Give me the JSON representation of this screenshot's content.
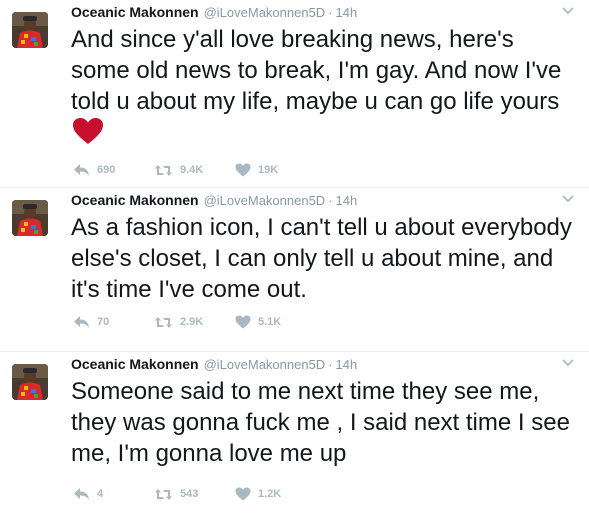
{
  "tweets": [
    {
      "name": "Oceanic Makonnen",
      "handle": "@iLoveMakonnen5D",
      "separator": "·",
      "time": "14h",
      "text": "And since y'all love breaking news, here's some old news to break, I'm gay. And now I've told u about my life, maybe u can go life yours",
      "has_heart_emoji": true,
      "replies": "690",
      "retweets": "9.4K",
      "likes": "19K"
    },
    {
      "name": "Oceanic Makonnen",
      "handle": "@iLoveMakonnen5D",
      "separator": "·",
      "time": "14h",
      "text": "As a fashion icon, I can't tell u about everybody else's closet, I can only tell u about mine, and it's time I've come out.",
      "has_heart_emoji": false,
      "replies": "70",
      "retweets": "2.9K",
      "likes": "5.1K"
    },
    {
      "name": "Oceanic Makonnen",
      "handle": "@iLoveMakonnen5D",
      "separator": "·",
      "time": "14h",
      "text": "Someone said to me next time they see me, they was gonna fuck me , I said next time I see me, I'm gonna love me up",
      "has_heart_emoji": false,
      "replies": "4",
      "retweets": "543",
      "likes": "1.2K"
    }
  ],
  "icons": {
    "reply": "reply-icon",
    "retweet": "retweet-icon",
    "like": "heart-icon",
    "more": "chevron-down-icon",
    "emoji": "red-heart-emoji"
  },
  "colors": {
    "text": "#14171a",
    "meta": "#8899a6",
    "action": "#aab8c2",
    "divider": "#e6ecf0",
    "heart_emoji": "#c8102e"
  }
}
